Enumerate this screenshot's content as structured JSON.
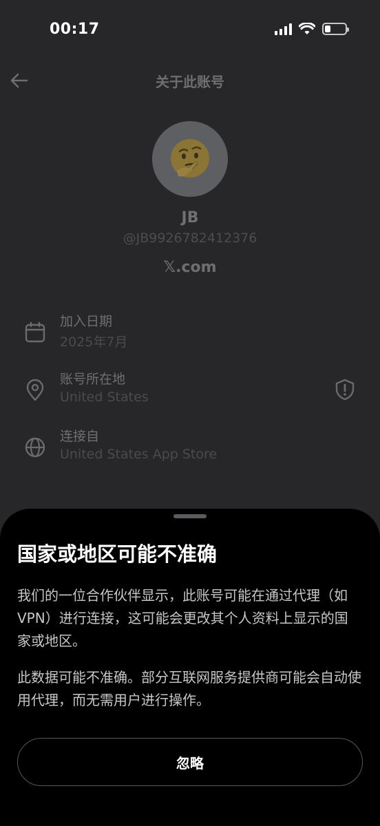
{
  "status_bar": {
    "time": "00:17",
    "icons": [
      "cellular-signal-icon",
      "wifi-icon",
      "battery-icon"
    ],
    "battery_level": 0.3
  },
  "header": {
    "back_icon": "arrow-left-icon",
    "title": "关于此账号"
  },
  "profile": {
    "avatar_icon": "thinking-face-emoji-icon",
    "display_name": "JB",
    "handle": "@JB9926782412376",
    "source": "𝕏.com"
  },
  "info_rows": [
    {
      "icon": "calendar-icon",
      "label": "加入日期",
      "value": "2025年7月"
    },
    {
      "icon": "location-pin-icon",
      "label": "账号所在地",
      "value": "United States",
      "trailing_icon": "shield-alert-icon"
    },
    {
      "icon": "globe-icon",
      "label": "连接自",
      "value": "United States App Store"
    }
  ],
  "sheet": {
    "title": "国家或地区可能不准确",
    "paragraph_1": "我们的一位合作伙伴显示，此账号可能在通过代理（如 VPN）进行连接，这可能会更改其个人资料上显示的国家或地区。",
    "paragraph_2": "此数据可能不准确。部分互联网服务提供商可能会自动使用代理，而无需用户进行操作。",
    "dismiss_label": "忽略"
  }
}
